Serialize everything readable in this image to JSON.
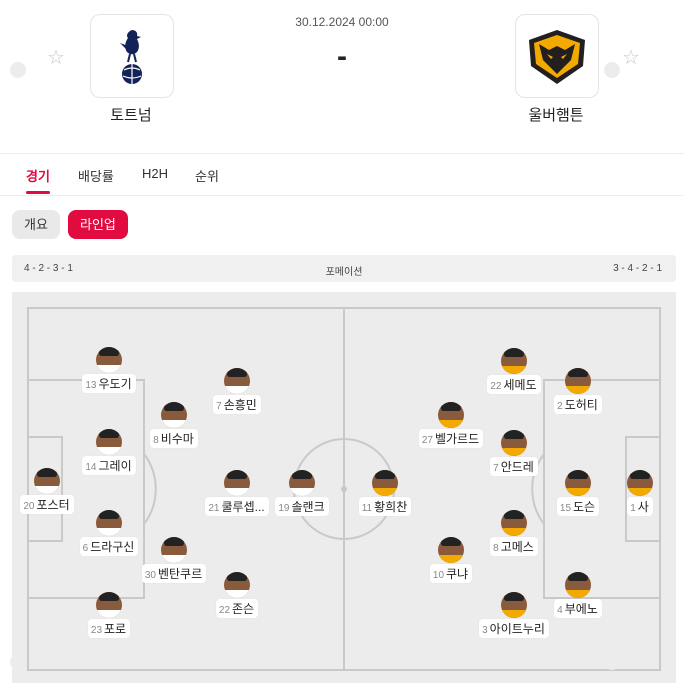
{
  "match": {
    "date": "30.12.2024 00:00",
    "score": "-",
    "home": {
      "name": "토트넘",
      "logo": "tottenham-logo"
    },
    "away": {
      "name": "울버햄튼",
      "logo": "wolves-logo"
    }
  },
  "tabs": [
    {
      "label": "경기",
      "active": true
    },
    {
      "label": "배당률",
      "active": false
    },
    {
      "label": "H2H",
      "active": false
    },
    {
      "label": "순위",
      "active": false
    }
  ],
  "subtabs": [
    {
      "label": "개요",
      "active": false
    },
    {
      "label": "라인업",
      "active": true
    }
  ],
  "formation": {
    "title": "포메이션",
    "home": "4 - 2 - 3 - 1",
    "away": "3 - 4 - 2 - 1"
  },
  "colors": {
    "accent": "#e10b3f",
    "home_shirt": "#ffffff",
    "away_shirt": "#f2a900"
  },
  "lineup": {
    "home": [
      {
        "num": "20",
        "name": "포스터"
      },
      {
        "num": "13",
        "name": "우도기"
      },
      {
        "num": "14",
        "name": "그레이"
      },
      {
        "num": "6",
        "name": "드라구신"
      },
      {
        "num": "23",
        "name": "포로"
      },
      {
        "num": "8",
        "name": "비수마"
      },
      {
        "num": "30",
        "name": "벤탄쿠르"
      },
      {
        "num": "7",
        "name": "손흥민"
      },
      {
        "num": "21",
        "name": "쿨루셉..."
      },
      {
        "num": "22",
        "name": "존슨"
      },
      {
        "num": "19",
        "name": "솔랜크"
      }
    ],
    "away": [
      {
        "num": "1",
        "name": "사"
      },
      {
        "num": "2",
        "name": "도허티"
      },
      {
        "num": "15",
        "name": "도슨"
      },
      {
        "num": "4",
        "name": "부에노"
      },
      {
        "num": "22",
        "name": "세메도"
      },
      {
        "num": "7",
        "name": "안드레"
      },
      {
        "num": "8",
        "name": "고메스"
      },
      {
        "num": "3",
        "name": "아이트누리"
      },
      {
        "num": "27",
        "name": "벨가르드"
      },
      {
        "num": "10",
        "name": "쿠냐"
      },
      {
        "num": "11",
        "name": "황희찬"
      }
    ]
  }
}
